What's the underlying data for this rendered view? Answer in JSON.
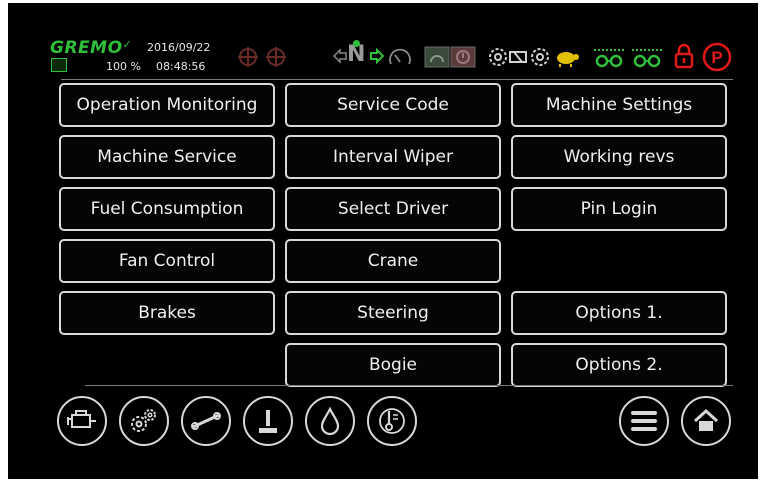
{
  "status": {
    "brand": "GREMO",
    "date": "2016/09/22",
    "percent": "100 %",
    "time": "08:48:56",
    "gear": "N",
    "colors": {
      "green": "#2fbf3a",
      "yellow": "#e0c000",
      "red": "#e01818",
      "gray": "#8a8a8a"
    },
    "icons": [
      "engine-oil-icon",
      "engine-oil-icon",
      "turn-left-icon",
      "neutral-gear-icon",
      "turn-right-icon",
      "speedometer-icon",
      "preheat-icon",
      "warning-lamp-icon",
      "transmission-icon",
      "gearbox-icon",
      "turtle-icon",
      "axle-lock-icon",
      "axle-lock-icon",
      "lock-icon",
      "parking-brake-icon"
    ]
  },
  "menu": [
    {
      "id": "operation-monitoring",
      "label": "Operation Monitoring"
    },
    {
      "id": "service-code",
      "label": "Service Code"
    },
    {
      "id": "machine-settings",
      "label": "Machine Settings"
    },
    {
      "id": "machine-service",
      "label": "Machine Service"
    },
    {
      "id": "interval-wiper",
      "label": "Interval Wiper"
    },
    {
      "id": "working-revs",
      "label": "Working revs"
    },
    {
      "id": "fuel-consumption",
      "label": "Fuel Consumption"
    },
    {
      "id": "select-driver",
      "label": "Select Driver"
    },
    {
      "id": "pin-login",
      "label": "Pin Login"
    },
    {
      "id": "fan-control",
      "label": "Fan Control"
    },
    {
      "id": "crane",
      "label": "Crane"
    },
    {
      "id": "brakes",
      "label": "Brakes"
    },
    {
      "id": "steering",
      "label": "Steering"
    },
    {
      "id": "options-1",
      "label": "Options 1."
    },
    {
      "id": "bogie",
      "label": "Bogie"
    },
    {
      "id": "options-2",
      "label": "Options 2."
    }
  ],
  "bottom_nav": [
    "engine-icon",
    "gears-icon",
    "driveline-icon",
    "joystick-icon",
    "fluid-drop-icon",
    "thermometer-gauge-icon",
    "menu-icon",
    "home-icon"
  ]
}
